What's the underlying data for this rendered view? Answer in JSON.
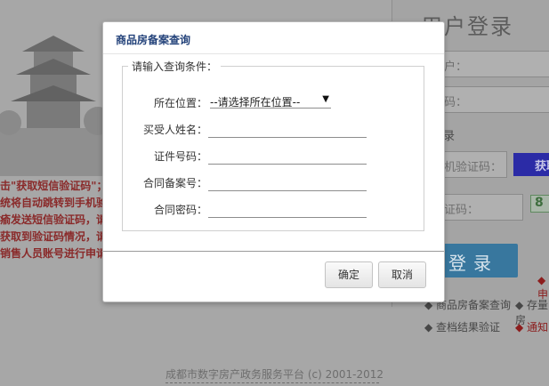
{
  "dialog": {
    "title": "商品房备案查询",
    "legend": "请输入查询条件：",
    "fields": {
      "location_label": "所在位置：",
      "location_value": "--请选择所在位置--",
      "buyer_label": "买受人姓名：",
      "id_label": "证件号码：",
      "contract_label": "合同备案号：",
      "password_label": "合同密码："
    },
    "ok_label": "确定",
    "cancel_label": "取消"
  },
  "background": {
    "login_title": "用户登录",
    "username_placeholder": "户：",
    "password_placeholder": "码：",
    "remember_label": "录",
    "sms_placeholder": "机验证码：",
    "get_code_label": "获取",
    "captcha_placeholder": "证码：",
    "captcha_value": "8",
    "login_label": "登录",
    "links": [
      "商品房备案查询",
      "存量房",
      "查档结果验证",
      "通知",
      "申"
    ],
    "notice_lines": [
      "击\"获取短信验证码\"；",
      "统将自动跳转到手机验",
      "瘉发送短信验证码，请",
      "获取到验证码情况，请",
      "销售人员账号进行申请"
    ],
    "footer": "成都市数字房产政务服务平台  (c) 2001-2012"
  }
}
